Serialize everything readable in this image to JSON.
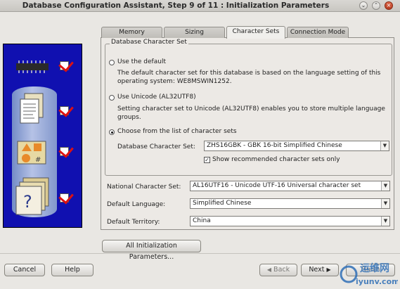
{
  "window": {
    "title": "Database Configuration Assistant, Step 9 of 11 : Initialization Parameters"
  },
  "tabs": [
    {
      "label": "Memory"
    },
    {
      "label": "Sizing"
    },
    {
      "label": "Character Sets"
    },
    {
      "label": "Connection Mode"
    }
  ],
  "active_tab": "Character Sets",
  "charset_group": {
    "legend": "Database Character Set",
    "use_default_label": "Use the default",
    "use_default_desc_1": "The default character set for this database is based on the language setting of this",
    "use_default_desc_2": "operating system: WE8MSWIN1252.",
    "use_unicode_label": "Use Unicode (AL32UTF8)",
    "use_unicode_desc_1": "Setting character set to Unicode (AL32UTF8) enables you to store multiple language",
    "use_unicode_desc_2": "groups.",
    "choose_label": "Choose from the list of character sets",
    "db_charset_label": "Database Character Set:",
    "db_charset_value": "ZHS16GBK - GBK 16-bit Simplified Chinese",
    "show_recommended_label": "Show recommended character sets only",
    "selected_option": "choose",
    "show_recommended_checked": true
  },
  "fields": {
    "national_label": "National Character Set:",
    "national_value": "AL16UTF16 - Unicode UTF-16 Universal character set",
    "language_label": "Default Language:",
    "language_value": "Simplified Chinese",
    "territory_label": "Default Territory:",
    "territory_value": "China"
  },
  "buttons": {
    "all_params": "All Initialization Parameters...",
    "cancel": "Cancel",
    "help": "Help",
    "back": "Back",
    "next": "Next",
    "finish": "Finish"
  },
  "watermark": {
    "line1": "运维网",
    "line2": "iyunv.com"
  },
  "colors": {
    "left_panel": "#1010b0",
    "check_mark": "#dd1111"
  },
  "icons": [
    "chip-icon",
    "document-icon",
    "shapes-icon",
    "help-document-icon",
    "checkmark-icon"
  ]
}
